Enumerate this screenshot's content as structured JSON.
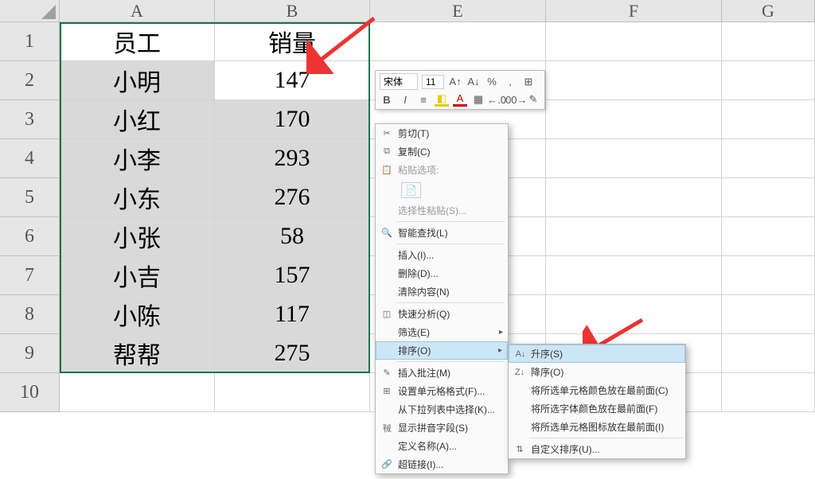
{
  "columns": {
    "a": "A",
    "b": "B",
    "e": "E",
    "f": "F",
    "g": "G"
  },
  "rows": [
    "1",
    "2",
    "3",
    "4",
    "5",
    "6",
    "7",
    "8",
    "9",
    "10"
  ],
  "header": {
    "a": "员工",
    "b": "销量"
  },
  "data": [
    {
      "a": "小明",
      "b": "147"
    },
    {
      "a": "小红",
      "b": "170"
    },
    {
      "a": "小李",
      "b": "293"
    },
    {
      "a": "小东",
      "b": "276"
    },
    {
      "a": "小张",
      "b": "58"
    },
    {
      "a": "小吉",
      "b": "157"
    },
    {
      "a": "小陈",
      "b": "117"
    },
    {
      "a": "帮帮",
      "b": "275"
    }
  ],
  "miniToolbar": {
    "fontName": "宋体",
    "fontSize": "11",
    "increaseFont": "A↑",
    "decreaseFont": "A↓",
    "percent": "%",
    "comma": ",",
    "bold": "B",
    "italic": "I",
    "align": "≡",
    "fill": "◧",
    "fontColor": "A",
    "border": "▦",
    "decInc": "←.0",
    "decDec": ".00→",
    "format": "✎"
  },
  "contextMenu": {
    "cut": "剪切(T)",
    "copy": "复制(C)",
    "pasteOptions": "粘贴选项:",
    "pasteSpecial": "选择性粘贴(S)...",
    "smartLookup": "智能查找(L)",
    "insert": "插入(I)...",
    "delete": "删除(D)...",
    "clearContents": "清除内容(N)",
    "quickAnalysis": "快速分析(Q)",
    "filter": "筛选(E)",
    "sort": "排序(O)",
    "insertComment": "插入批注(M)",
    "formatCells": "设置单元格格式(F)...",
    "pickFromList": "从下拉列表中选择(K)...",
    "showPhonetic": "显示拼音字段(S)",
    "defineName": "定义名称(A)...",
    "hyperlink": "超链接(I)..."
  },
  "sortSubmenu": {
    "ascending": "升序(S)",
    "descending": "降序(O)",
    "cellColor": "将所选单元格颜色放在最前面(C)",
    "fontColor": "将所选字体颜色放在最前面(F)",
    "cellIcon": "将所选单元格图标放在最前面(I)",
    "customSort": "自定义排序(U)..."
  }
}
